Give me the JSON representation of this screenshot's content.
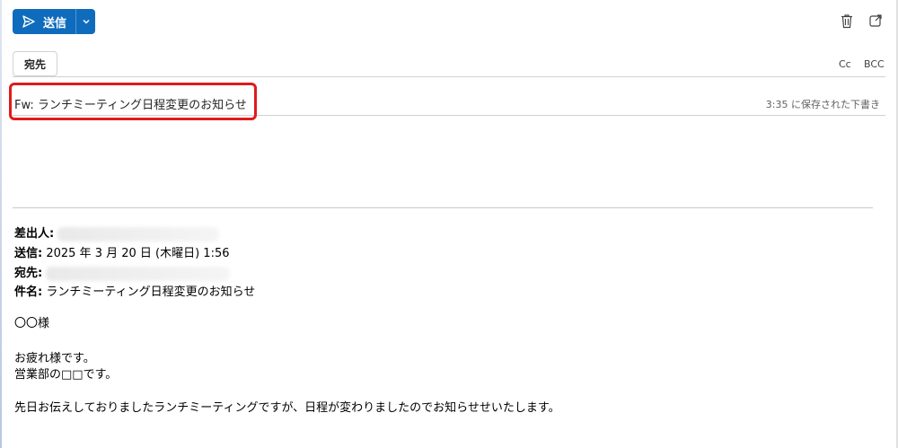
{
  "toolbar": {
    "send_label": "送信",
    "icons": {
      "send": "send-icon",
      "dropdown": "chevron-down-icon",
      "trash": "trash-icon",
      "popout": "popout-icon"
    },
    "accent_color": "#0f6cbd"
  },
  "recipients": {
    "to_label": "宛先",
    "cc_label": "Cc",
    "bcc_label": "BCC"
  },
  "subject": {
    "value": "Fw: ランチミーティング日程変更のお知らせ",
    "draft_status": "3:35 に保存された下書き",
    "highlight_color": "#e01b1b"
  },
  "forwarded": {
    "from_label": "差出人:",
    "sent_label": "送信:",
    "sent_value": "2025 年 3 月 20 日 (木曜日) 1:56",
    "to_label": "宛先:",
    "subject_label": "件名:",
    "subject_value": "ランチミーティング日程変更のお知らせ"
  },
  "message": {
    "greeting": "〇〇様",
    "line1": "お疲れ様です。",
    "line2": "営業部の□□です。",
    "line3": "先日お伝えしておりましたランチミーティングですが、日程が変わりましたのでお知らせせいたします。"
  }
}
